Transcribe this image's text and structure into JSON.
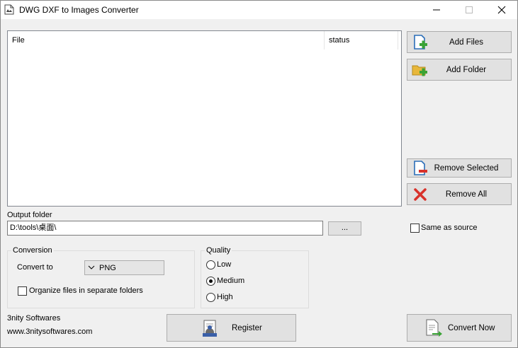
{
  "window": {
    "title": "DWG DXF to Images Converter"
  },
  "file_list": {
    "columns": [
      "File",
      "status"
    ],
    "rows": []
  },
  "actions": {
    "add_files": "Add Files",
    "add_folder": "Add Folder",
    "remove_selected": "Remove Selected",
    "remove_all": "Remove All"
  },
  "output": {
    "label": "Output folder",
    "path": "D:\\tools\\桌面\\",
    "browse_label": "...",
    "same_as_source_label": "Same as source",
    "same_as_source_checked": false
  },
  "conversion": {
    "group_title": "Conversion",
    "convert_to_label": "Convert to",
    "format": "PNG",
    "organize_label": "Organize files in separate folders",
    "organize_checked": false
  },
  "quality": {
    "group_title": "Quality",
    "options": [
      "Low",
      "Medium",
      "High"
    ],
    "selected": "Medium"
  },
  "footer": {
    "company": "3nity Softwares",
    "website": "www.3nitysoftwares.com",
    "register_label": "Register",
    "convert_label": "Convert Now"
  },
  "colors": {
    "window_bg": "#f0f0f0",
    "button_bg": "#e1e1e1",
    "accent_blue": "#2a6db8",
    "accent_green": "#3aa335",
    "accent_red": "#d8312a",
    "folder_yellow": "#e8b73a"
  }
}
